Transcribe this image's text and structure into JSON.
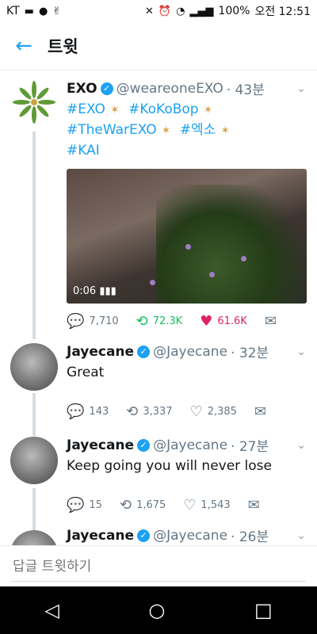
{
  "status": {
    "carrier": "KT",
    "battery": "100%",
    "time": "오전 12:51"
  },
  "header": {
    "title": "트윗"
  },
  "tweets": [
    {
      "name": "EXO",
      "handle": "@weareoneEXO",
      "time": "· 43분",
      "body": {
        "tag1": "#EXO",
        "tag2": "#KoKoBop",
        "tag3": "#TheWarEXO",
        "tag4": "#엑소",
        "tag5": "#KAI"
      },
      "video": {
        "duration": "0:06"
      },
      "stats": {
        "replies": "7,710",
        "retweets": "72.3K",
        "likes": "61.6K"
      }
    },
    {
      "name": "Jayecane",
      "handle": "@Jayecane",
      "time": "· 32분",
      "text": "Great",
      "stats": {
        "replies": "143",
        "retweets": "3,337",
        "likes": "2,385"
      }
    },
    {
      "name": "Jayecane",
      "handle": "@Jayecane",
      "time": "· 27분",
      "text": "Keep going you will never lose",
      "stats": {
        "replies": "15",
        "retweets": "1,675",
        "likes": "1,543"
      }
    },
    {
      "name": "Jayecane",
      "handle": "@Jayecane",
      "time": "· 26분"
    }
  ],
  "reply": {
    "placeholder": "답글 트윗하기"
  },
  "icons": {
    "back": "arrow-left-icon",
    "reply": "reply-icon",
    "retweet": "retweet-icon",
    "like": "heart-icon",
    "dm": "mail-icon"
  },
  "colors": {
    "accent": "#1da1f2",
    "retweet": "#17bf63",
    "like": "#e0245e"
  }
}
